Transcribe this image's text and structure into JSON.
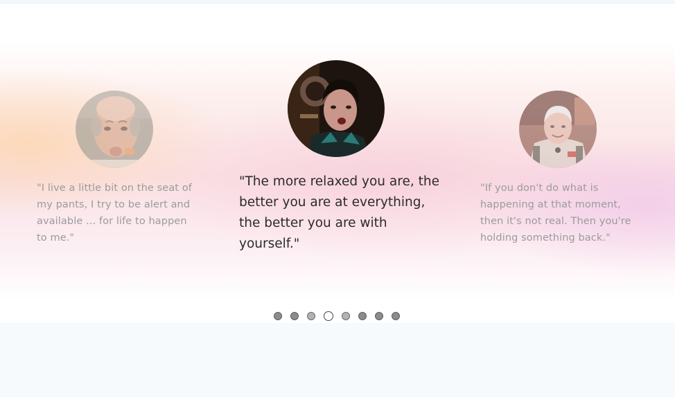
{
  "carousel": {
    "slides": [
      {
        "position": "previous",
        "image_alt": "bald man with lips pursed",
        "quote": "\"I live a little bit on the seat of my pants, I try to be alert and available ... for life to happen to me.\""
      },
      {
        "position": "current",
        "image_alt": "man in dark shirt speaking",
        "quote": "\"The more relaxed you are, the better you are at everything, the better you are with yourself.\""
      },
      {
        "position": "next",
        "image_alt": "grey-haired man in jumpsuit",
        "quote": "\"If you don't do what is happening at that moment, then it's not real. Then you're holding something back.\""
      }
    ],
    "pagination": {
      "count": 8,
      "active_index": 3
    }
  },
  "colors": {
    "quote_active": "#2b2b2b",
    "quote_inactive": "#9b9b9b",
    "warm_glow": "#fcd4aa",
    "pink_glow": "#f0c6e8"
  }
}
